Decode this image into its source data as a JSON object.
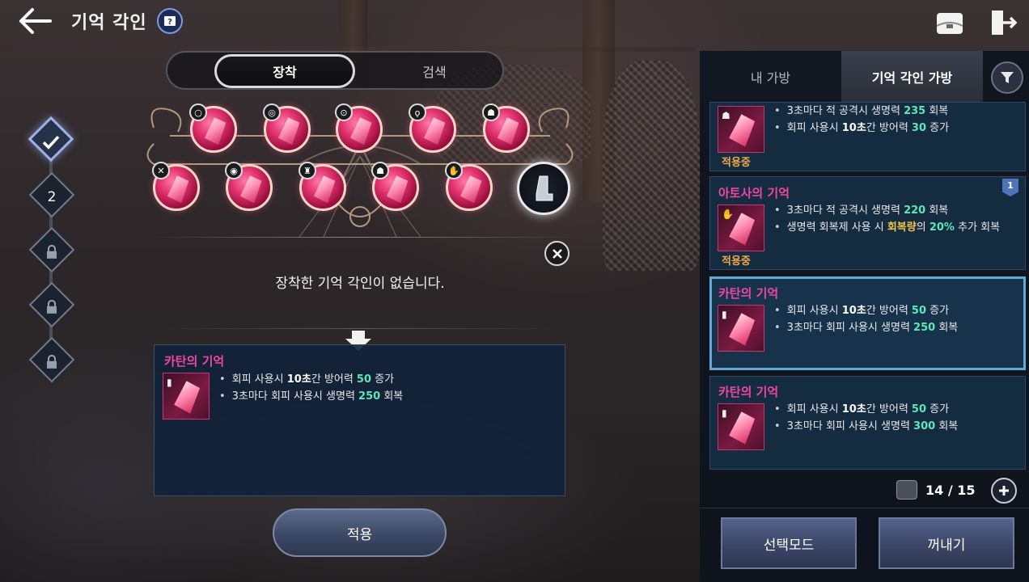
{
  "header": {
    "title": "기억 각인",
    "help_icon": "help-book-icon",
    "top_right_icons": [
      "storage-box-icon",
      "exit-door-icon"
    ]
  },
  "tabs": {
    "equip_label": "장착",
    "search_label": "검색",
    "active": "장착"
  },
  "slots": {
    "row1": [
      {
        "badge": "ring-icon",
        "filled": true
      },
      {
        "badge": "necklace-icon",
        "filled": true
      },
      {
        "badge": "bracelet-icon",
        "filled": true
      },
      {
        "badge": "earring-icon",
        "filled": true
      },
      {
        "badge": "helmet-icon",
        "filled": true
      }
    ],
    "row2": [
      {
        "badge": "sword-icon",
        "filled": true
      },
      {
        "badge": "shield-icon",
        "filled": true
      },
      {
        "badge": "armor-icon",
        "filled": true
      },
      {
        "badge": "helmet-icon",
        "filled": true
      },
      {
        "badge": "gauntlet-icon",
        "filled": true
      },
      {
        "badge": "boots-icon",
        "filled": false
      }
    ]
  },
  "empty_message": "장착한 기억 각인이 없습니다.",
  "detail": {
    "name": "카탄의 기억",
    "effects": [
      {
        "pre": "회피 사용시 ",
        "hl1": "10초",
        "mid": "간 방어력 ",
        "hl2": "50",
        "post": " 증가"
      },
      {
        "pre": "3초마다 회피 사용시 생명력 ",
        "hl1": "",
        "mid": "",
        "hl2": "250",
        "post": " 회복"
      }
    ]
  },
  "apply_label": "적용",
  "stages": {
    "stage2": "2"
  },
  "right_panel": {
    "tab_my_bag": "내 가방",
    "tab_imprint_bag": "기억 각인 가방",
    "cards": [
      {
        "name": "",
        "status": "적용중",
        "level": "",
        "effects": [
          {
            "pre": "3초마다 적 공격시 생명력 ",
            "hl": "235",
            "post": " 회복"
          },
          {
            "pre": "회피 사용시 ",
            "hlw": "10초",
            "mid": "간 방어력 ",
            "hl": "30",
            "post": " 증가"
          }
        ]
      },
      {
        "name": "아토사의 기억",
        "status": "적용중",
        "level": "1",
        "effects": [
          {
            "pre": "3초마다 적 공격시 생명력 ",
            "hl": "220",
            "post": " 회복"
          },
          {
            "pre": "생명력 회복제 사용 시 ",
            "hly": "회복량",
            "mid": "의 ",
            "hl": "20%",
            "post": " 추가 회복"
          }
        ]
      },
      {
        "name": "카탄의 기억",
        "status": "",
        "level": "",
        "selected": true,
        "effects": [
          {
            "pre": "회피 사용시 ",
            "hlw": "10초",
            "mid": "간 방어력 ",
            "hl": "50",
            "post": " 증가"
          },
          {
            "pre": "3초마다 회피 사용시 생명력 ",
            "hl": "250",
            "post": " 회복"
          }
        ]
      },
      {
        "name": "카탄의 기억",
        "status": "",
        "level": "",
        "effects": [
          {
            "pre": "회피 사용시 ",
            "hlw": "10초",
            "mid": "간 방어력 ",
            "hl": "50",
            "post": " 증가"
          },
          {
            "pre": "3초마다 회피 사용시 생명력 ",
            "hl": "300",
            "post": " 회복"
          }
        ]
      }
    ],
    "capacity": "14 / 15",
    "select_mode_label": "선택모드",
    "take_out_label": "꺼내기"
  },
  "colors": {
    "accent_pink": "#f046a4",
    "highlight_green": "#5de6ba",
    "status_orange": "#f0a84a",
    "panel_blue": "#152c42"
  }
}
